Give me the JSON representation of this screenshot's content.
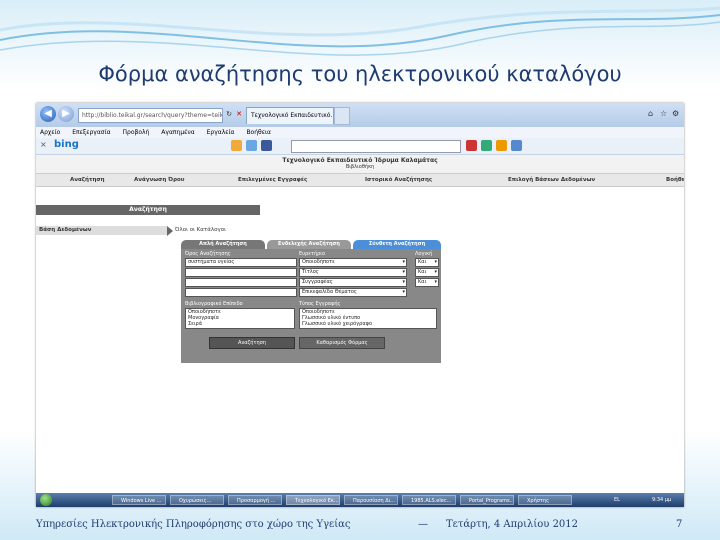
{
  "slide": {
    "title": "Φόρμα αναζήτησης του ηλεκτρονικού καταλόγου",
    "footer_left": "Υπηρεσίες Ηλεκτρονικής Πληροφόρησης στο χώρο της Υγείας",
    "footer_dash": "—",
    "footer_date": "Τετάρτη, 4 Απριλίου 2012",
    "page_number": "7"
  },
  "browser": {
    "address": "http://biblio.teikal.gr/search/query?theme=teikal",
    "tab_label": "Τεχνολογικό Εκπαιδευτικό...",
    "menu": [
      "Αρχείο",
      "Επεξεργασία",
      "Προβολή",
      "Αγαπημένα",
      "Εργαλεία",
      "Βοήθεια"
    ],
    "search_brand": "bing",
    "close_glyph": "×"
  },
  "library": {
    "header_line1": "Τεχνολογικό Εκπαιδευτικό Ίδρυμα Καλαμάτας",
    "header_line2": "Βιβλιοθήκη",
    "nav": [
      "Αναζήτηση",
      "Ανάγνωση Όρου",
      "Επιλεγμένες Εγγραφές",
      "Ιστορικό Αναζήτησης",
      "Επιλογή Βάσεων Δεδομένων",
      "Βοήθεια"
    ],
    "side_heading": "Αναζήτηση",
    "db_label": "Βάση Δεδομένων",
    "db_value": "Όλοι οι Κατάλογοι"
  },
  "form": {
    "tabs": [
      "Απλή Αναζήτηση",
      "Ενδελεχής Αναζήτηση",
      "Σύνθετη Αναζήτηση"
    ],
    "term_label": "Όρος Αναζήτησης",
    "field_label": "Ευρετήριο",
    "operator_label": "Λογική",
    "terms": [
      "συστήματα υγείας",
      "",
      ""
    ],
    "fields": [
      "Οποιοδήποτε",
      "Τίτλος",
      "Συγγραφέας",
      "Επικεφαλίδα Θέματος"
    ],
    "operators": [
      "Και",
      "Και",
      "Και"
    ],
    "material_label": "Βιβλιογραφικό Επίπεδο",
    "materials": [
      "Οποιοδήποτε",
      "Μονογραφία",
      "Σειρά"
    ],
    "record_type_label": "Τύπος Εγγραφής",
    "record_types": [
      "Οποιοδήποτε",
      "Γλωσσικό υλικό έντυπο",
      "Γλωσσικό υλικό χειρόγραφο"
    ],
    "search_button": "Αναζήτηση",
    "clear_button": "Καθαρισμός Φόρμας"
  },
  "taskbar": {
    "items": [
      "Windows Live ...",
      "Οχυρώσεις...",
      "Προσαρμογή ...",
      "Τεχνολογικό Εκ...",
      "Παρουσίαση Δι...",
      "1985.ALS.elec...",
      "Portal_Programs...",
      "Χρήστης"
    ],
    "lang": "EL",
    "time": "9:34 μμ"
  }
}
